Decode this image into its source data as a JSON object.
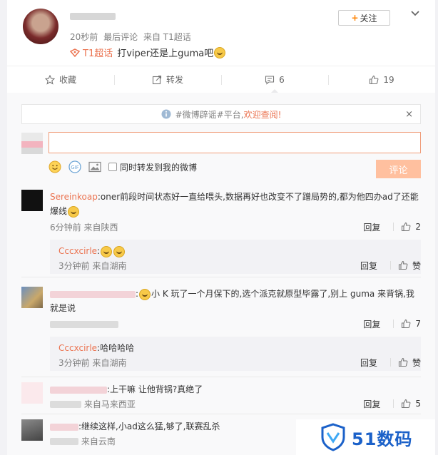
{
  "post": {
    "time": "20秒前",
    "last_comment": "最后评论",
    "source": "来自 T1超话",
    "topic": "T1超话",
    "text": "打viper还是上guma吧",
    "follow_label": "关注"
  },
  "actions": {
    "collect": "收藏",
    "repost": "转发",
    "comment_count": "6",
    "like_count": "19"
  },
  "notice": {
    "text": "#微博辟谣#平台,",
    "highlight": "欢迎查阅!",
    "close": "×"
  },
  "composer": {
    "input_value": "",
    "repost_label": "同时转发到我的微博",
    "submit_label": "评论"
  },
  "comments": [
    {
      "user": "Sereinkoap",
      "text": ":oner前段时间状态好一直给喂头,数据再好也改变不了蹭局势的,都为他四办ad了还能爆线",
      "meta": "6分钟前 来自陕西",
      "reply": "回复",
      "likes": "2",
      "sub": {
        "user": "Cccxcirle",
        "text": ":",
        "meta": "3分钟前 来自湖南",
        "reply": "回复",
        "likes": "赞"
      }
    },
    {
      "user": "",
      "text": "小 K 玩了一个月保下的,选个派克就原型毕露了,别上 guma 来背锅,我就是说",
      "meta": "",
      "reply": "回复",
      "likes": "7",
      "sub": {
        "user": "Cccxcirle",
        "text": ":哈哈哈哈",
        "meta": "3分钟前 来自湖南",
        "reply": "回复",
        "likes": "赞"
      }
    },
    {
      "user": "",
      "text": ":上干嘛 让他背锅?真绝了",
      "meta": "来自马来西亚",
      "reply": "回复",
      "likes": "5"
    },
    {
      "user": "",
      "text": ":继续这样,小ad这么猛,够了,联赛乱杀",
      "meta": "来自云南"
    }
  ],
  "watermark": "51数码",
  "colors": {
    "accent": "#eb7350",
    "follow_plus": "#ff8200",
    "submit_bg": "#ffc09f",
    "watermark": "#1b61c9"
  }
}
